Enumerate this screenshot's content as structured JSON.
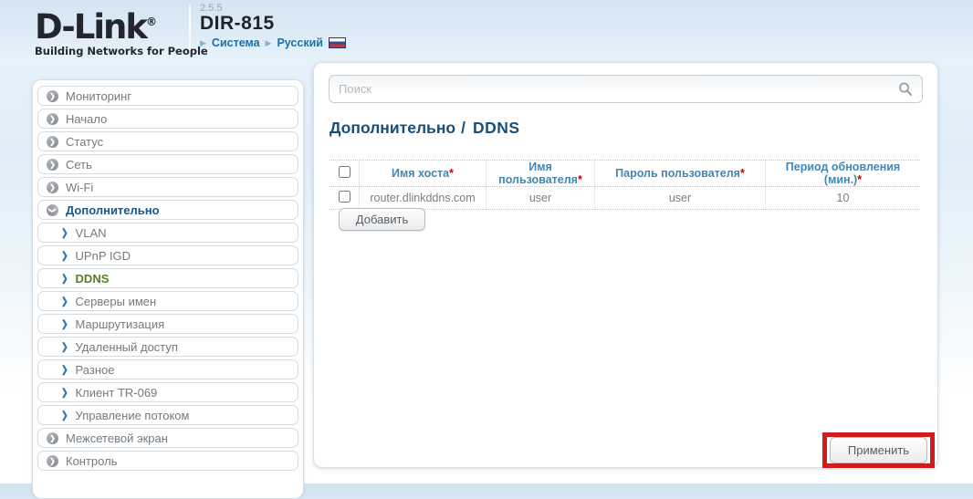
{
  "header": {
    "brand": "D-Link",
    "registered": "®",
    "tagline": "Building Networks for People",
    "firmware_version": "2.5.5",
    "model": "DIR-815",
    "nav": [
      {
        "label": "Система"
      },
      {
        "label": "Русский"
      }
    ],
    "language_flag": "russia-flag-icon"
  },
  "sidebar": {
    "items": [
      {
        "label": "Мониторинг",
        "level": 0
      },
      {
        "label": "Начало",
        "level": 0
      },
      {
        "label": "Статус",
        "level": 0
      },
      {
        "label": "Сеть",
        "level": 0
      },
      {
        "label": "Wi-Fi",
        "level": 0
      },
      {
        "label": "Дополнительно",
        "level": 0,
        "expanded": true,
        "active_parent": true
      },
      {
        "label": "VLAN",
        "level": 1
      },
      {
        "label": "UPnP IGD",
        "level": 1
      },
      {
        "label": "DDNS",
        "level": 1,
        "active": true
      },
      {
        "label": "Серверы имен",
        "level": 1
      },
      {
        "label": "Маршрутизация",
        "level": 1
      },
      {
        "label": "Удаленный доступ",
        "level": 1
      },
      {
        "label": "Разное",
        "level": 1
      },
      {
        "label": "Клиент TR-069",
        "level": 1
      },
      {
        "label": "Управление потоком",
        "level": 1
      },
      {
        "label": "Межсетевой экран",
        "level": 0
      },
      {
        "label": "Контроль",
        "level": 0
      }
    ]
  },
  "main": {
    "search": {
      "placeholder": "Поиск"
    },
    "title": {
      "section": "Дополнительно",
      "separator": "/",
      "page": "DDNS"
    },
    "table": {
      "columns": [
        {
          "label": "Имя хоста",
          "required": "*"
        },
        {
          "label": "Имя пользователя",
          "required": "*"
        },
        {
          "label": "Пароль пользователя",
          "required": "*"
        },
        {
          "label": "Период обновления (мин.)",
          "required": "*"
        }
      ],
      "row": {
        "host": "router.dlinkddns.com",
        "username": "user",
        "password": "user",
        "period": "10"
      }
    },
    "buttons": {
      "add": "Добавить",
      "apply": "Применить"
    }
  },
  "colors": {
    "title_blue": "#174f7c",
    "table_header_blue": "#4186b5",
    "active_parent_blue": "#1b578a",
    "active_item_green": "#55821c",
    "header_link_blue": "#1b6fa8",
    "required_red": "#cc0000",
    "annotation_red": "#cf1d1d"
  }
}
